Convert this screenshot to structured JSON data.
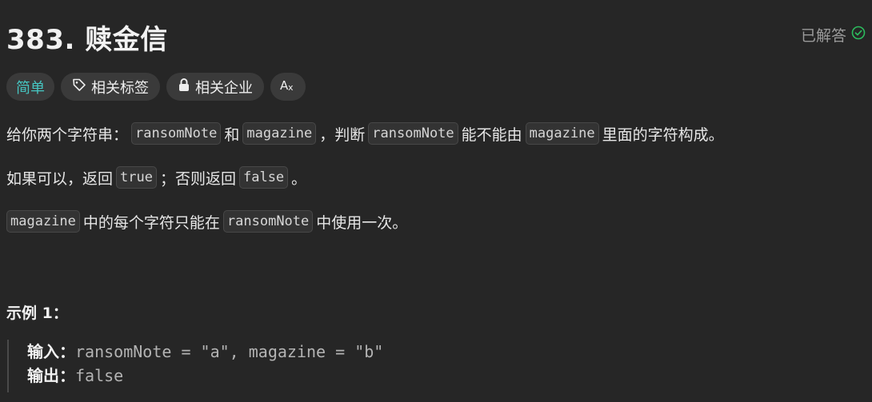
{
  "problem": {
    "title": "383. 赎金信",
    "status_label": "已解答"
  },
  "tags": {
    "difficulty": "简单",
    "related_tags": "相关标签",
    "related_companies": "相关企业",
    "translate_icon": "translate-icon"
  },
  "description": {
    "line1": {
      "t1": "给你两个字符串：",
      "c1": "ransomNote",
      "t2": "和",
      "c2": "magazine",
      "t3": "，判断",
      "c3": "ransomNote",
      "t4": "能不能由",
      "c4": "magazine",
      "t5": "里面的字符构成。"
    },
    "line2": {
      "t1": "如果可以，返回",
      "c1": "true",
      "t2": "；否则返回",
      "c2": "false",
      "t3": "。"
    },
    "line3": {
      "c1": "magazine",
      "t1": "中的每个字符只能在",
      "c2": "ransomNote",
      "t2": "中使用一次。"
    }
  },
  "example1": {
    "title": "示例 1：",
    "input_label": "输入：",
    "input_value": "ransomNote = \"a\", magazine = \"b\"",
    "output_label": "输出：",
    "output_value": "false"
  },
  "colors": {
    "background": "#262626",
    "easy": "#46c6c2",
    "solved_check": "#2cbb5d"
  }
}
